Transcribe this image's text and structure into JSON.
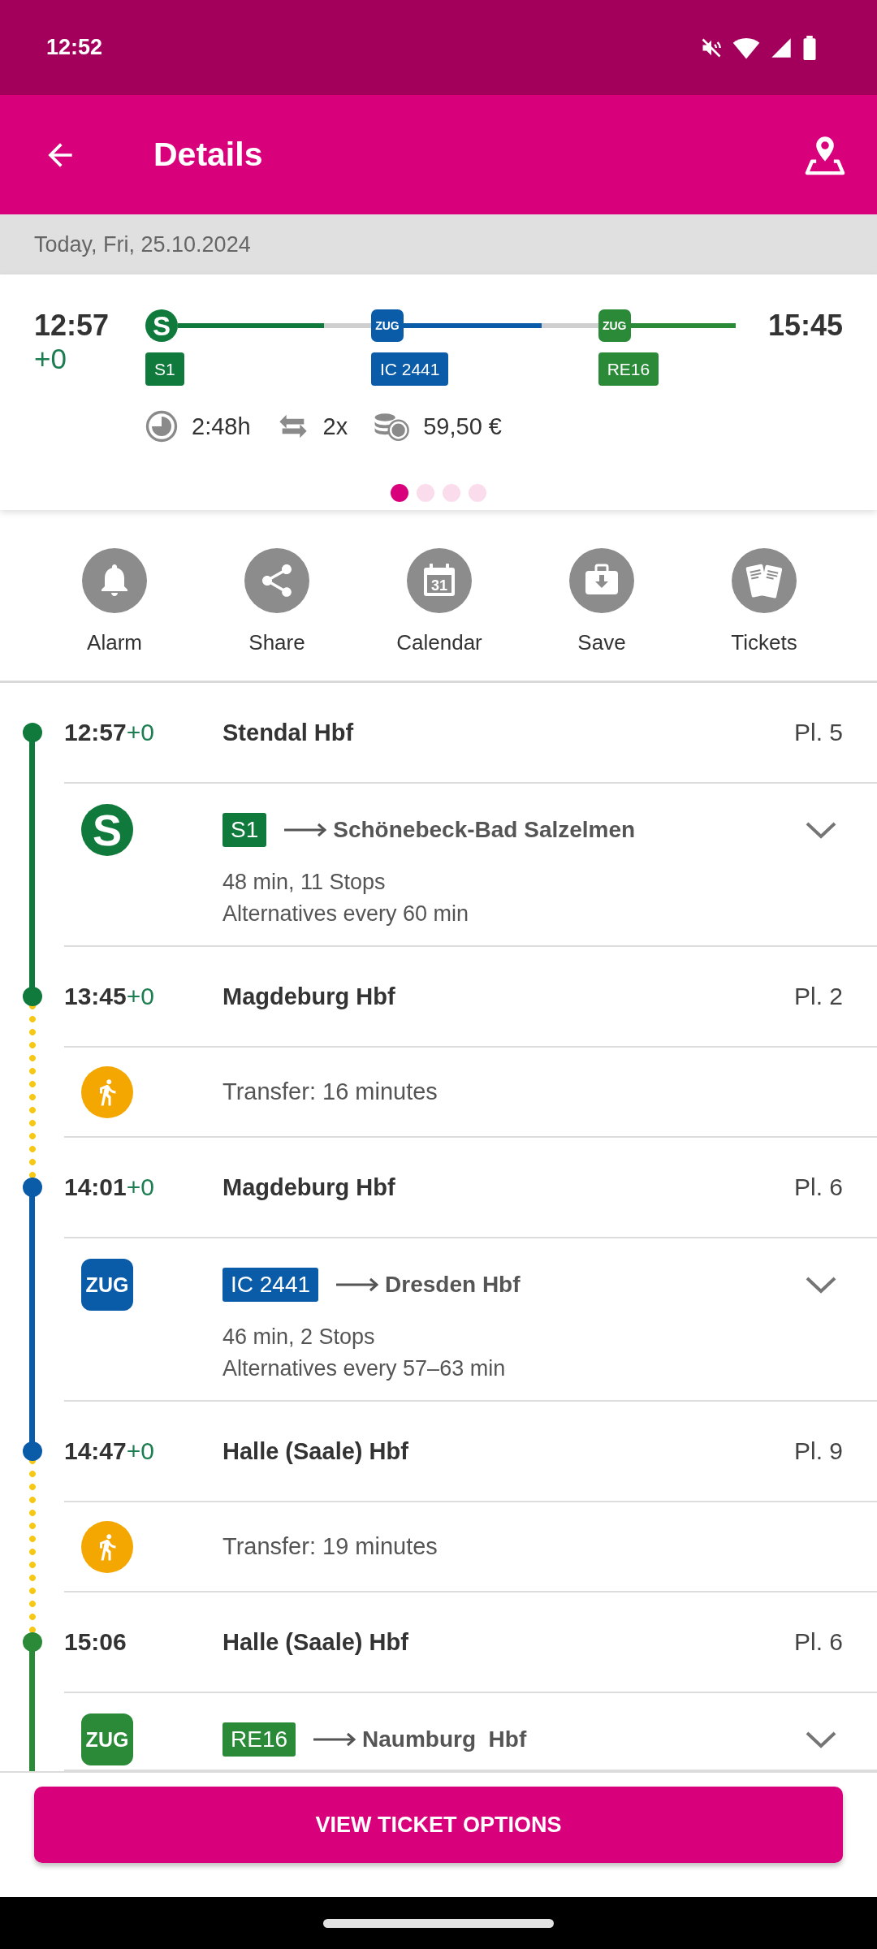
{
  "status_bar": {
    "time": "12:52"
  },
  "app_bar": {
    "title": "Details"
  },
  "date_bar": {
    "text": "Today, Fri, 25.10.2024"
  },
  "summary": {
    "departure": "12:57",
    "departure_delay": "+0",
    "arrival": "15:45",
    "legs": [
      {
        "kind": "sbahn",
        "mode_label": "S",
        "line": "S1",
        "color": "#0f7a3c"
      },
      {
        "kind": "train",
        "mode_label": "ZUG",
        "line": "IC 2441",
        "color": "#0a5ca9"
      },
      {
        "kind": "train",
        "mode_label": "ZUG",
        "line": "RE16",
        "color": "#2a8a38"
      }
    ],
    "duration": "2:48h",
    "transfers": "2x",
    "price": "59,50 €",
    "pages": [
      {
        "selected": true
      },
      {
        "selected": false
      },
      {
        "selected": false
      },
      {
        "selected": false
      }
    ]
  },
  "actions": [
    {
      "kind": "alarm",
      "label": "Alarm"
    },
    {
      "kind": "share",
      "label": "Share"
    },
    {
      "kind": "calendar",
      "label": "Calendar",
      "icon_text": "31"
    },
    {
      "kind": "save",
      "label": "Save"
    },
    {
      "kind": "tickets",
      "label": "Tickets"
    }
  ],
  "itinerary": [
    {
      "kind": "stop",
      "time": "12:57",
      "delay": "+0",
      "station": "Stendal Hbf",
      "platform": "Pl. 5"
    },
    {
      "kind": "leg",
      "logo": {
        "kind": "sbahn",
        "label": "S"
      },
      "line": "S1",
      "color": "#0f7a3c",
      "destination": "Schönebeck-Bad Salzelmen",
      "duration_stops": "48 min, 11 Stops",
      "alternatives": "Alternatives every 60 min",
      "expanded": false
    },
    {
      "kind": "stop",
      "time": "13:45",
      "delay": "+0",
      "station": "Magdeburg Hbf",
      "platform": "Pl. 2"
    },
    {
      "kind": "transfer",
      "text": "Transfer: 16 minutes"
    },
    {
      "kind": "stop",
      "time": "14:01",
      "delay": "+0",
      "station": "Magdeburg Hbf",
      "platform": "Pl. 6"
    },
    {
      "kind": "leg",
      "logo": {
        "kind": "train",
        "label": "ZUG"
      },
      "line": "IC 2441",
      "color": "#0a5ca9",
      "destination": "Dresden Hbf",
      "duration_stops": "46 min, 2 Stops",
      "alternatives": "Alternatives every 57–63 min",
      "expanded": false
    },
    {
      "kind": "stop",
      "time": "14:47",
      "delay": "+0",
      "station": "Halle (Saale) Hbf",
      "platform": "Pl. 9"
    },
    {
      "kind": "transfer",
      "text": "Transfer: 19 minutes"
    },
    {
      "kind": "stop",
      "time": "15:06",
      "station": "Halle (Saale) Hbf",
      "platform": "Pl. 6"
    },
    {
      "kind": "leg",
      "logo": {
        "kind": "train",
        "label": "ZUG"
      },
      "line": "RE16",
      "color": "#2a8a38",
      "destination": "Naumburg  Hbf",
      "expanded": false
    }
  ],
  "primary_button": {
    "label": "VIEW TICKET OPTIONS"
  }
}
